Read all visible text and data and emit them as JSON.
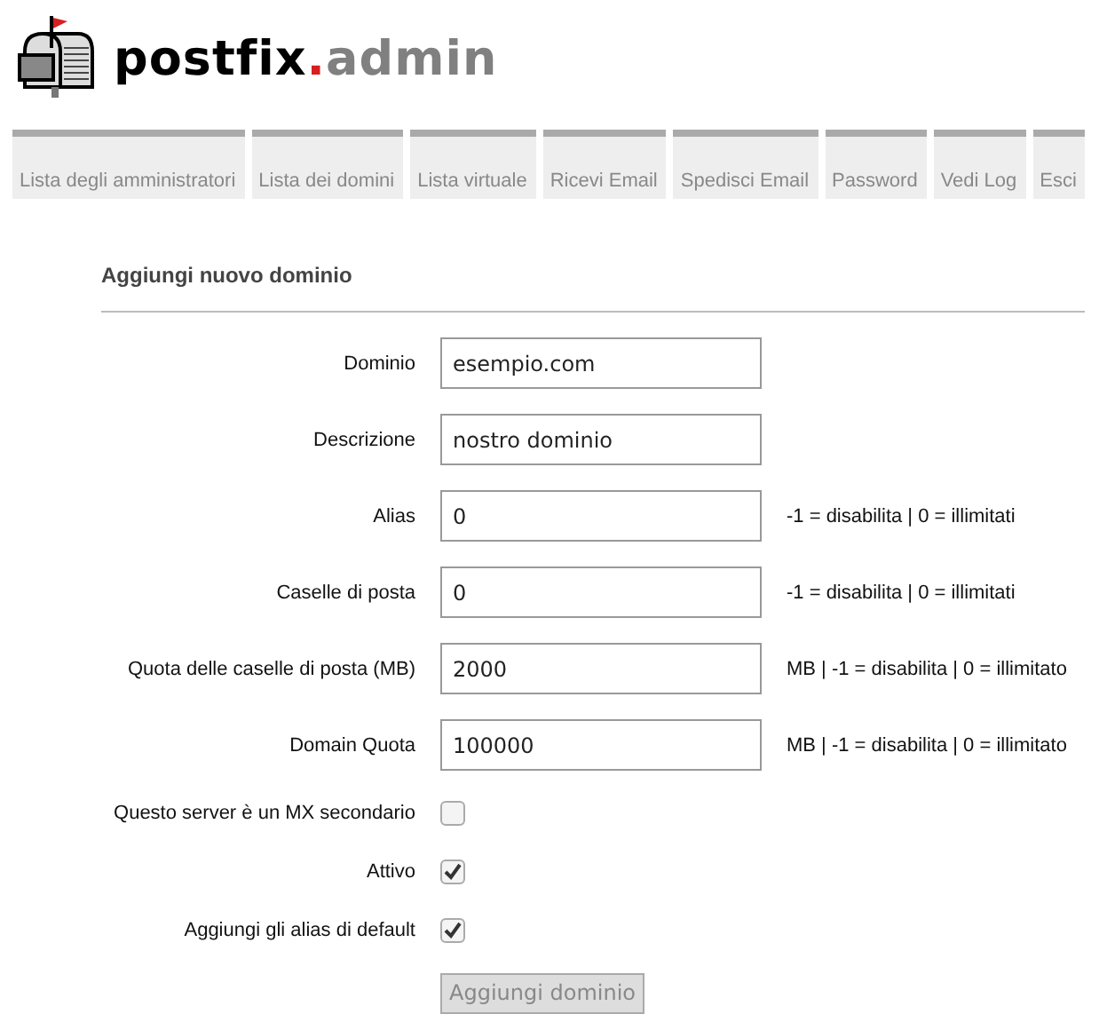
{
  "logo": {
    "name": "postfix",
    "dot": ".",
    "suffix": "admin"
  },
  "nav": [
    {
      "label": "Lista degli amministratori"
    },
    {
      "label": "Lista dei domini"
    },
    {
      "label": "Lista virtuale"
    },
    {
      "label": "Ricevi Email"
    },
    {
      "label": "Spedisci Email"
    },
    {
      "label": "Password"
    },
    {
      "label": "Vedi Log"
    },
    {
      "label": "Esci"
    }
  ],
  "form": {
    "title": "Aggiungi nuovo dominio",
    "fields": [
      {
        "kind": "text",
        "label": "Dominio",
        "value": "esempio.com"
      },
      {
        "kind": "text",
        "label": "Descrizione",
        "value": "nostro dominio"
      },
      {
        "kind": "text",
        "label": "Alias",
        "value": "0",
        "hint": "-1 = disabilita | 0 = illimitati"
      },
      {
        "kind": "text",
        "label": "Caselle di posta",
        "value": "0",
        "hint": "-1 = disabilita | 0 = illimitati"
      },
      {
        "kind": "text",
        "label": "Quota delle caselle di posta (MB)",
        "value": "2000",
        "hint": "MB | -1 = disabilita | 0 = illimitato"
      },
      {
        "kind": "text",
        "label": "Domain Quota",
        "value": "100000",
        "hint": "MB | -1 = disabilita | 0 = illimitato"
      },
      {
        "kind": "checkbox",
        "label": "Questo server è un MX secondario",
        "checked": false
      },
      {
        "kind": "checkbox",
        "label": "Attivo",
        "checked": true
      },
      {
        "kind": "checkbox",
        "label": "Aggiungi gli alias di default",
        "checked": true
      }
    ],
    "submit": {
      "label": "Aggiungi dominio",
      "disabled": true
    }
  }
}
